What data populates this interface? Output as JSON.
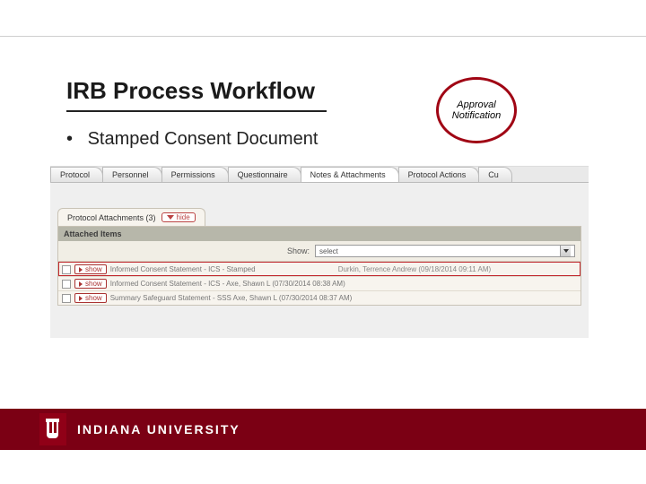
{
  "slide": {
    "title": "IRB Process Workflow",
    "bullet": "Stamped Consent Document",
    "callout": "Approval Notification"
  },
  "screenshot": {
    "tabs": [
      "Protocol",
      "Personnel",
      "Permissions",
      "Questionnaire",
      "Notes & Attachments",
      "Protocol Actions",
      "Cu"
    ],
    "section": {
      "label": "Protocol Attachments (3)",
      "hide": "hide"
    },
    "panel_header": "Attached Items",
    "show_filter": {
      "label": "Show:",
      "value": "select"
    },
    "rows": [
      {
        "show": "show",
        "name": "Informed Consent Statement - ICS - Stamped",
        "meta": "Durkin, Terrence Andrew (09/18/2014 09:11 AM)",
        "selected": true
      },
      {
        "show": "show",
        "name": "Informed Consent Statement - ICS - Axe, Shawn L (07/30/2014 08:38 AM)",
        "meta": "",
        "selected": false
      },
      {
        "show": "show",
        "name": "Summary Safeguard Statement - SSS   Axe, Shawn L (07/30/2014 08:37 AM)",
        "meta": "",
        "selected": false
      }
    ]
  },
  "footer": {
    "org": "INDIANA UNIVERSITY"
  }
}
